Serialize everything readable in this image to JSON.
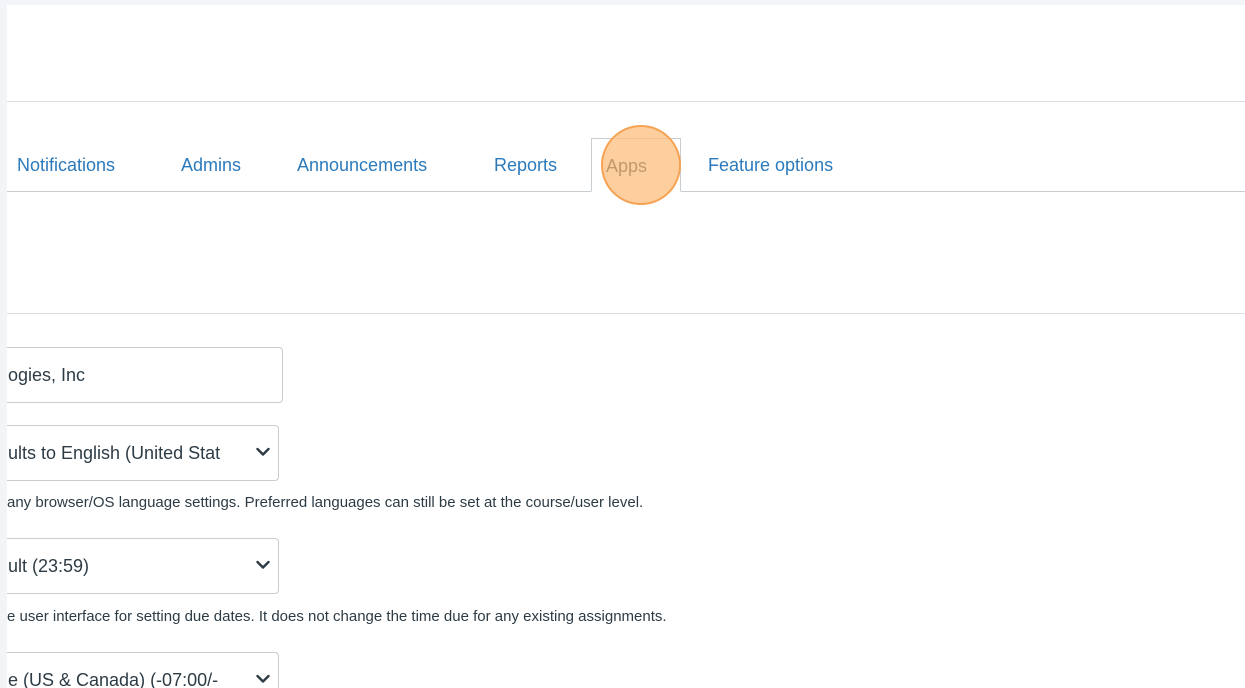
{
  "tabs": [
    {
      "label": "Notifications",
      "active": false
    },
    {
      "label": "Admins",
      "active": false
    },
    {
      "label": "Announcements",
      "active": false
    },
    {
      "label": "Reports",
      "active": false
    },
    {
      "label": "Apps",
      "active": true
    },
    {
      "label": "Feature options",
      "active": false
    }
  ],
  "form": {
    "account_name_value": "ogies, Inc",
    "language_select_value": "ults to English (United Stat",
    "language_help": "any browser/OS language settings. Preferred languages can still be set at the course/user level.",
    "due_time_select_value": "ult (23:59)",
    "due_time_help": "e user interface for setting due dates. It does not change the time due for any existing assignments.",
    "timezone_select_value": "e (US & Canada) (-07:00/-"
  },
  "colors": {
    "link": "#2b7abc",
    "text": "#2d3b45",
    "border": "#c7cdd1",
    "click_marker": "#fcbc78"
  },
  "icons": {
    "select_caret": "chevron-down-icon"
  }
}
